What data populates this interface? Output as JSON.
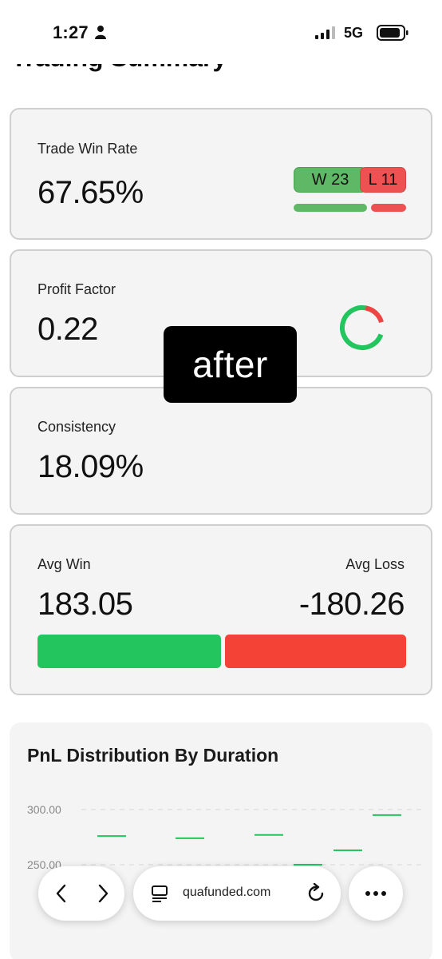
{
  "status_bar": {
    "time": "1:27",
    "network": "5G"
  },
  "section_title": "Trading Summary",
  "cards": {
    "win_rate": {
      "label": "Trade Win Rate",
      "value": "67.65%",
      "wins": "W 23",
      "losses": "L 11",
      "win_count": 23,
      "loss_count": 11
    },
    "profit_factor": {
      "label": "Profit Factor",
      "value": "0.22"
    },
    "consistency": {
      "label": "Consistency",
      "value": "18.09%"
    },
    "avg": {
      "win_label": "Avg Win",
      "win_value": "183.05",
      "loss_label": "Avg Loss",
      "loss_value": "-180.26"
    }
  },
  "overlay": {
    "text": "after"
  },
  "chart": {
    "title": "PnL Distribution By Duration",
    "chart_data": {
      "type": "scatter",
      "title": "PnL Distribution By Duration",
      "y_ticks": [
        "300.00",
        "250.00"
      ],
      "ylim": [
        250,
        300
      ],
      "grid": true,
      "points": [
        276,
        274,
        277,
        250,
        263,
        295
      ]
    }
  },
  "browser": {
    "url": "quafunded.com"
  },
  "colors": {
    "green": "#22c55e",
    "red": "#f44336",
    "win_badge": "#5fb866",
    "loss_badge": "#ee5151"
  }
}
